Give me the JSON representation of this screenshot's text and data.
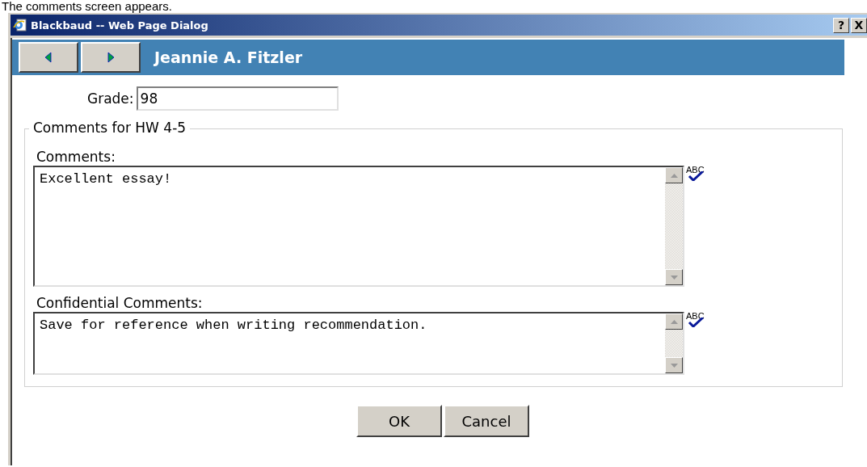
{
  "caption": "The comments screen appears.",
  "window": {
    "title": "Blackbaud -- Web Page Dialog",
    "controls": [
      "?",
      "X"
    ]
  },
  "header": {
    "name": "Jeannie A. Fitzler"
  },
  "grade": {
    "label": "Grade:",
    "value": "98"
  },
  "group": {
    "legend": "Comments for HW 4-5",
    "fields": [
      {
        "label": "Comments:",
        "value": "Excellent essay!",
        "spellcheck": "ABC",
        "kind": "tall"
      },
      {
        "label": "Confidential Comments:",
        "value": "Save for reference when writing recommendation.",
        "spellcheck": "ABC",
        "kind": "short"
      }
    ]
  },
  "buttons": [
    "OK",
    "Cancel"
  ]
}
